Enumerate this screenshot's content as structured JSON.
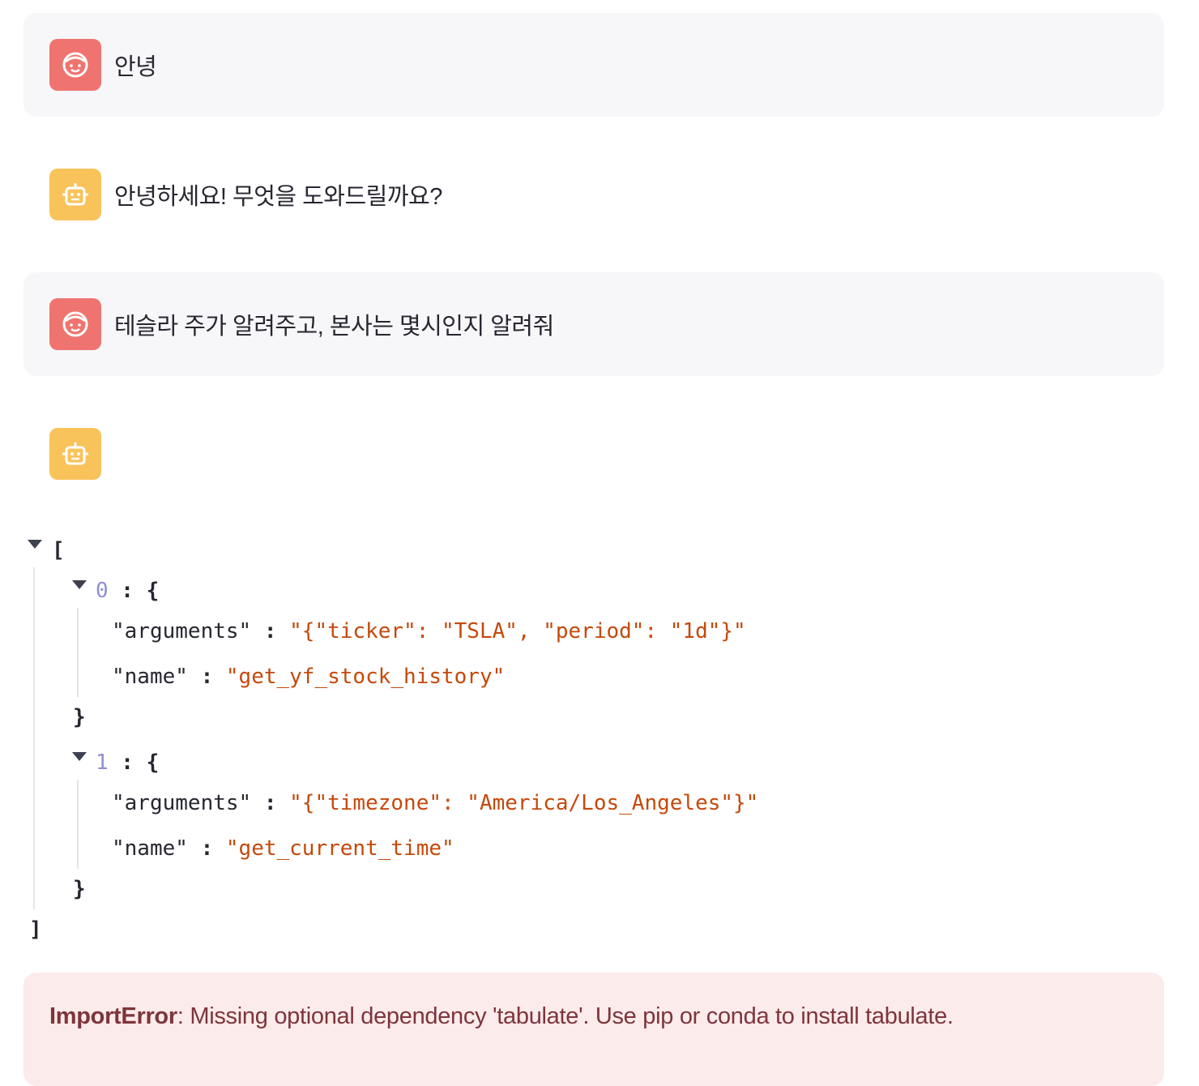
{
  "messages": [
    {
      "role": "user",
      "avatar_icon": "face-icon",
      "text": "안녕"
    },
    {
      "role": "assistant",
      "avatar_icon": "robot-icon",
      "text": "안녕하세요! 무엇을 도와드릴까요?"
    },
    {
      "role": "user",
      "avatar_icon": "face-icon",
      "text": "테슬라 주가 알려주고, 본사는 몇시인지 알려줘"
    },
    {
      "role": "assistant",
      "avatar_icon": "robot-icon",
      "text": ""
    }
  ],
  "json_viewer": {
    "open_bracket": "[",
    "close_bracket": "]",
    "items": [
      {
        "index": "0",
        "open": "{",
        "close": "}",
        "fields": [
          {
            "key": "\"arguments\"",
            "value": "\"{\"ticker\": \"TSLA\", \"period\": \"1d\"}\""
          },
          {
            "key": "\"name\"",
            "value": "\"get_yf_stock_history\""
          }
        ]
      },
      {
        "index": "1",
        "open": "{",
        "close": "}",
        "fields": [
          {
            "key": "\"arguments\"",
            "value": "\"{\"timezone\": \"America/Los_Angeles\"}\""
          },
          {
            "key": "\"name\"",
            "value": "\"get_current_time\""
          }
        ]
      }
    ]
  },
  "error": {
    "type": "ImportError",
    "message": ": Missing optional dependency 'tabulate'. Use pip or conda to install tabulate."
  },
  "colors": {
    "user_avatar": "#ef7470",
    "bot_avatar": "#f9c35b",
    "string_value": "#c5490b",
    "index": "#8f8fd0",
    "error_bg": "#fcebeb",
    "error_text": "#7d353b"
  }
}
